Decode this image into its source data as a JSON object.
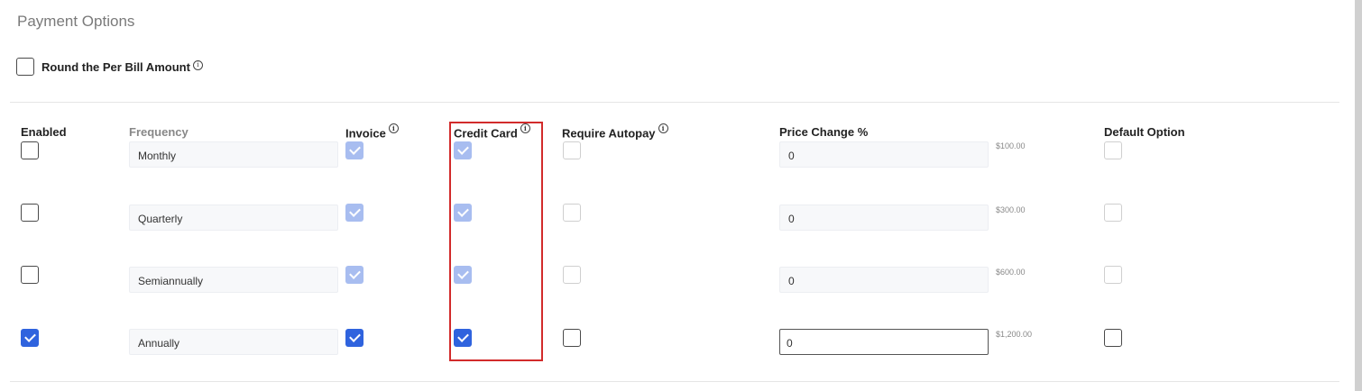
{
  "section": {
    "title": "Payment Options"
  },
  "round_option": {
    "label": "Round the Per Bill Amount",
    "checked": false
  },
  "columns": {
    "enabled": "Enabled",
    "frequency": "Frequency",
    "invoice": "Invoice",
    "credit_card": "Credit Card",
    "require_autopay": "Require Autopay",
    "price_change": "Price Change %",
    "default_option": "Default Option"
  },
  "rows": [
    {
      "enabled": false,
      "frequency": "Monthly",
      "invoice": true,
      "credit_card": true,
      "require_autopay": false,
      "price_change": "0",
      "amount": "$100.00",
      "default_option": false
    },
    {
      "enabled": false,
      "frequency": "Quarterly",
      "invoice": true,
      "credit_card": true,
      "require_autopay": false,
      "price_change": "0",
      "amount": "$300.00",
      "default_option": false
    },
    {
      "enabled": false,
      "frequency": "Semiannually",
      "invoice": true,
      "credit_card": true,
      "require_autopay": false,
      "price_change": "0",
      "amount": "$600.00",
      "default_option": false
    },
    {
      "enabled": true,
      "frequency": "Annually",
      "invoice": true,
      "credit_card": true,
      "require_autopay": false,
      "price_change": "0",
      "amount": "$1,200.00",
      "default_option": false
    }
  ],
  "colors": {
    "accent": "#2f63de",
    "accent_disabled": "#a8bdf0",
    "highlight": "#d22b2b"
  }
}
